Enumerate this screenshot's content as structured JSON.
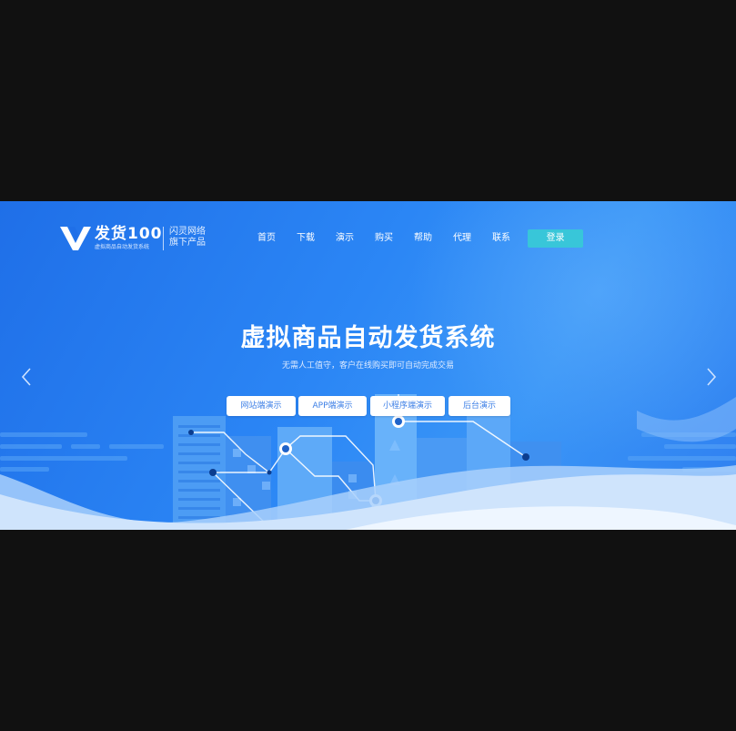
{
  "header": {
    "logo_name": "发货100",
    "logo_subtitle": "虚拟商品自动发货系统",
    "logo_tag_line1": "闪灵网络",
    "logo_tag_line2": "旗下产品",
    "nav": [
      {
        "label": "首页"
      },
      {
        "label": "下载"
      },
      {
        "label": "演示"
      },
      {
        "label": "购买"
      },
      {
        "label": "帮助"
      },
      {
        "label": "代理"
      },
      {
        "label": "联系"
      }
    ],
    "login_label": "登录"
  },
  "hero": {
    "title": "虚拟商品自动发货系统",
    "subtitle": "无需人工值守，客户在线购买即可自动完成交易",
    "demo_buttons": [
      {
        "label": "网站端演示"
      },
      {
        "label": "APP端演示"
      },
      {
        "label": "小程序端演示"
      },
      {
        "label": "后台演示"
      }
    ],
    "prev_icon": "chevron-left-icon",
    "next_icon": "chevron-right-icon"
  },
  "colors": {
    "page_background": "#111111",
    "hero_blue": "#2b86f5",
    "login_button": "#38c6d9",
    "demo_button_text": "#3c7fe6"
  }
}
